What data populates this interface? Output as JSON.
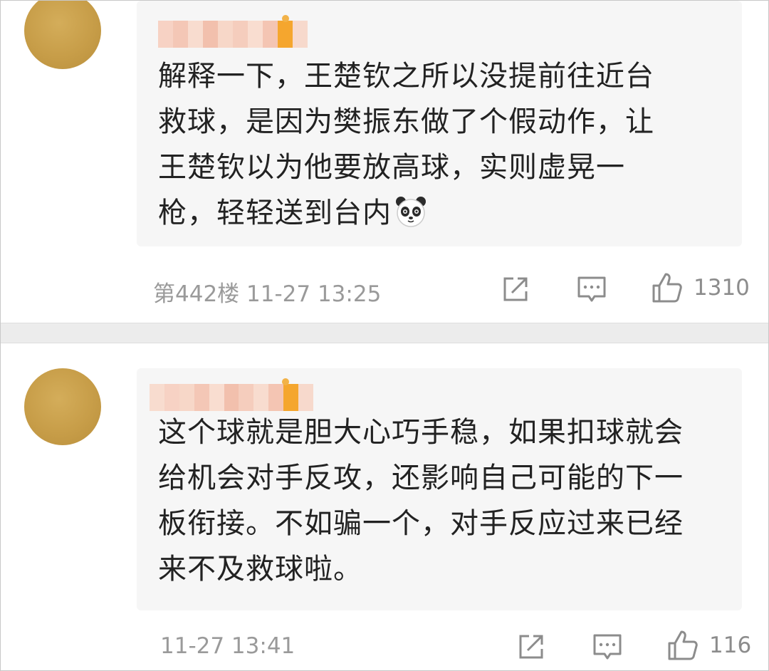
{
  "comments": [
    {
      "text_lines": [
        "解释一下，王楚钦之所以没提前往近台",
        "救球，是因为樊振东做了个假动作，让",
        "王楚钦以为他要放高球，实则虚晃一",
        "枪，轻轻送到台内"
      ],
      "emoji": "panda-emoji",
      "floor": "第442楼",
      "time": "11-27 13:25",
      "likes": "1310"
    },
    {
      "text_lines": [
        "这个球就是胆大心巧手稳，如果扣球就会",
        "给机会对手反攻，还影响自己可能的下一",
        "板衔接。不如骗一个，对手反应过来已经",
        "来不及救球啦。"
      ],
      "time": "11-27 13:41",
      "likes": "116"
    }
  ],
  "icons": {
    "share": "share-icon",
    "reply": "comment-icon",
    "like": "thumbs-up-icon"
  },
  "colors": {
    "avatar": "#c79d48",
    "bubble": "#f6f6f6",
    "meta_text": "#9a9a9a",
    "separator": "#ececec"
  }
}
